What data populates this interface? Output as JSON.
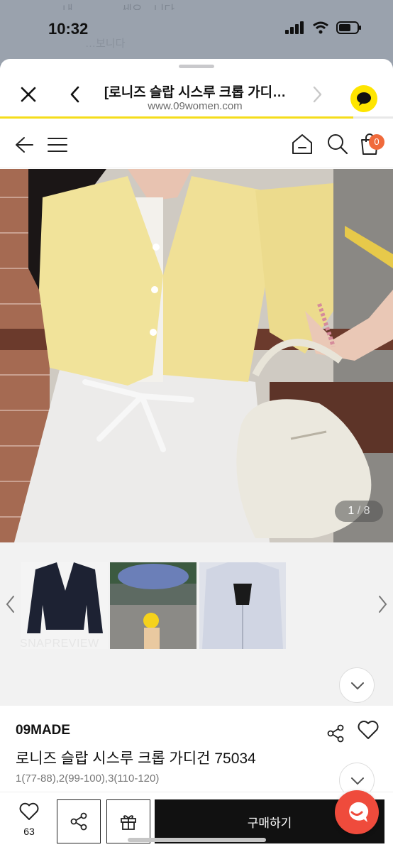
{
  "status": {
    "time": "10:32"
  },
  "background": {
    "ghost_text_1": "내 …………세요…니다",
    "ghost_text_2": "…보니다"
  },
  "browser": {
    "title": "[로니즈 슬랍 시스루 크롭 가디…",
    "url": "www.09women.com"
  },
  "site_nav": {
    "cart_count": "0"
  },
  "hero": {
    "current": "1",
    "separator": "/",
    "total": "8"
  },
  "thumbs": {
    "watermark": "SNAPREVIEW"
  },
  "product": {
    "brand": "09MADE",
    "name": "로니즈 슬랍 시스루 크롭 가디건 75034",
    "sizes": "1(77-88),2(99-100),3(110-120)"
  },
  "bottom_bar": {
    "like_count": "63",
    "buy_label": "구매하기"
  },
  "colors": {
    "accent_yellow": "#fee500",
    "progress": "#f5dd1b",
    "cart_badge": "#f06a3b",
    "chat_fab": "#ef4b3c",
    "buy_button": "#111111"
  },
  "icons": [
    "close-icon",
    "chevron-left-icon",
    "chevron-right-icon",
    "kakao-chat-icon",
    "arrow-left-icon",
    "menu-icon",
    "home-icon",
    "search-icon",
    "cart-icon",
    "share-icon",
    "heart-icon",
    "gift-icon",
    "chevron-up-icon",
    "chevron-down-icon",
    "chat-icon"
  ]
}
